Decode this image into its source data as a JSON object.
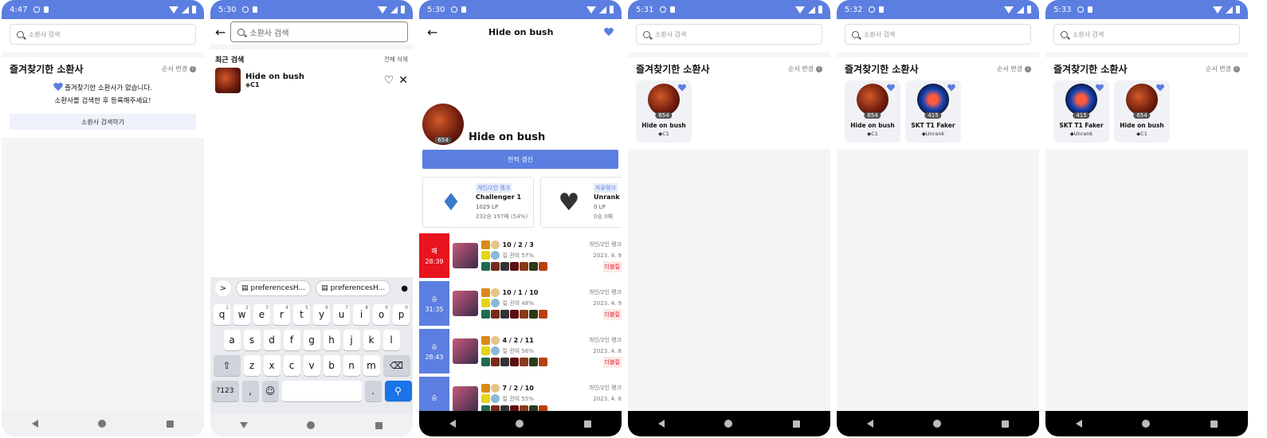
{
  "screens": [
    {
      "time": "4:47"
    },
    {
      "time": "5:30"
    },
    {
      "time": "5:30"
    },
    {
      "time": "5:31"
    },
    {
      "time": "5:32"
    },
    {
      "time": "5:33"
    }
  ],
  "search": {
    "placeholder": "소환사 검색"
  },
  "favorites": {
    "title": "즐겨찾기한 소환사",
    "order_label": "순서 변경",
    "empty_line1": "즐겨찾기한 소환사가 없습니다.",
    "empty_line2": "소환사를 검색한 후 등록해주세요!",
    "search_button": "소환사 검색하기"
  },
  "recent": {
    "title": "최근 검색",
    "clear_all": "전체 삭제",
    "item": {
      "name": "Hide on bush",
      "rank": "C1"
    }
  },
  "keyboard": {
    "suggestions": [
      "preferencesH...",
      "preferencesH..."
    ],
    "row1": [
      "q",
      "w",
      "e",
      "r",
      "t",
      "y",
      "u",
      "i",
      "o",
      "p"
    ],
    "row1_hints": [
      "1",
      "2",
      "3",
      "4",
      "5",
      "6",
      "7",
      "8",
      "9",
      "0"
    ],
    "row2": [
      "a",
      "s",
      "d",
      "f",
      "g",
      "h",
      "j",
      "k",
      "l"
    ],
    "row3": [
      "z",
      "x",
      "c",
      "v",
      "b",
      "n",
      "m"
    ],
    "symbols_key": "?123",
    "comma": ",",
    "period": "."
  },
  "profile": {
    "header_title": "Hide on bush",
    "name": "Hide on bush",
    "level": "654",
    "refresh_button": "전적 갱신",
    "ranks": [
      {
        "queue": "개인/2인 랭크",
        "tier": "Challenger 1",
        "lp": "1029 LP",
        "record": "232승 197패 (54%)"
      },
      {
        "queue": "자유랭크",
        "tier": "Unrank",
        "lp": "0 LP",
        "record": "0승 0패"
      }
    ],
    "matches": [
      {
        "result": "패",
        "duration": "28:39",
        "kda": "10 / 2 / 3",
        "kp": "킬 관여 57%",
        "queue": "개인/2인 랭크",
        "date": "2023. 4. 9",
        "badge": "더블킬",
        "color": "#e8141e"
      },
      {
        "result": "승",
        "duration": "31:35",
        "kda": "10 / 1 / 10",
        "kp": "킬 관여 48%",
        "queue": "개인/2인 랭크",
        "date": "2023. 4. 9",
        "badge": "더블킬",
        "color": "#5b7ee0"
      },
      {
        "result": "승",
        "duration": "28:43",
        "kda": "4 / 2 / 11",
        "kp": "킬 관여 56%",
        "queue": "개인/2인 랭크",
        "date": "2023. 4. 8",
        "badge": "더블킬",
        "color": "#5b7ee0"
      },
      {
        "result": "승",
        "duration": "",
        "kda": "7 / 2 / 10",
        "kp": "킬 관여 55%",
        "queue": "개인/2인 랭크",
        "date": "2023. 4. 8",
        "badge": "",
        "color": "#5b7ee0"
      }
    ]
  },
  "cards": {
    "hide": {
      "name": "Hide on bush",
      "level": "654",
      "rank": "C1"
    },
    "faker": {
      "name": "SKT T1 Faker",
      "level": "415",
      "rank": "Unrank"
    }
  }
}
